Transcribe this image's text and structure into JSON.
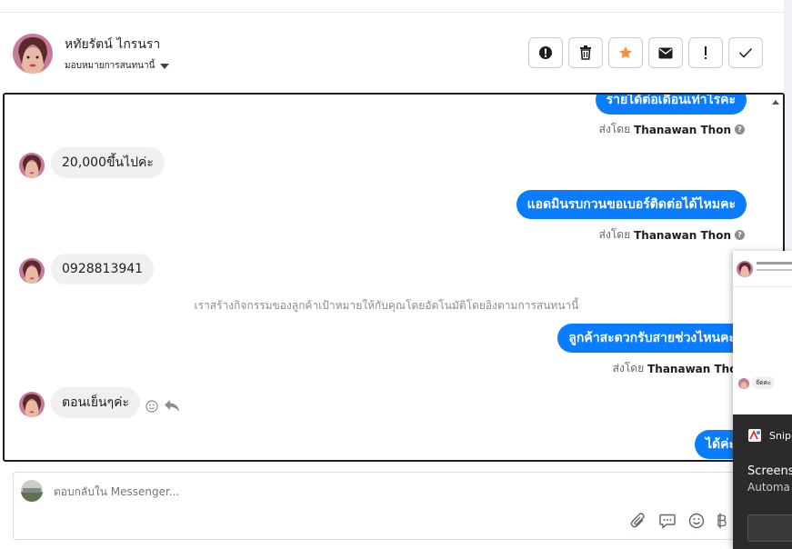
{
  "header": {
    "name": "หทัยรัตน์ ไกรนรา",
    "assign_label": "มอบหมายการสนทนานี้",
    "tools": [
      {
        "icon": "alert-circle-icon"
      },
      {
        "icon": "trash-icon"
      },
      {
        "icon": "star-icon",
        "color": "#f7923a"
      },
      {
        "icon": "mail-icon"
      },
      {
        "icon": "exclamation-icon"
      },
      {
        "icon": "check-icon"
      }
    ]
  },
  "chat": {
    "messages": [
      {
        "from": "page",
        "text": "รายได้ต่อเดือนเท่าไรคะ",
        "sent_by_prefix": "ส่งโดย",
        "sent_by": "Thanawan Thon"
      },
      {
        "from": "customer",
        "text": "20,000ขึ้นไปค่ะ"
      },
      {
        "from": "page",
        "text": "แอดมินรบกวนขอเบอร์ติดต่อได้ไหมคะ",
        "sent_by_prefix": "ส่งโดย",
        "sent_by": "Thanawan Thon"
      },
      {
        "from": "customer",
        "text": "0928813941"
      },
      {
        "from": "system",
        "text": "เราสร้างกิจกรรมของลูกค้าเป้าหมายให้กับคุณโดยอัตโนมัติโดยอิงตามการสนทนานี้"
      },
      {
        "from": "page",
        "text": "ลูกค้าสะดวกรับสายช่วงไหนคะ",
        "sent_by_prefix": "ส่งโดย",
        "sent_by": "Thanawan Thon"
      },
      {
        "from": "customer",
        "text": "ตอนเย็นๆค่ะ"
      },
      {
        "from": "page",
        "text": "ได้ค่ะ"
      }
    ],
    "accent_color": "#0a7cff"
  },
  "reply": {
    "placeholder": "ตอบกลับใน Messenger...",
    "icons": [
      "paperclip-icon",
      "chat-bubble-icon",
      "emoji-icon",
      "baht-icon"
    ]
  },
  "popup": {
    "reply_chip": "จัดคะ",
    "app_title": "Snip",
    "line1": "Screensh",
    "line2": "Automa"
  }
}
